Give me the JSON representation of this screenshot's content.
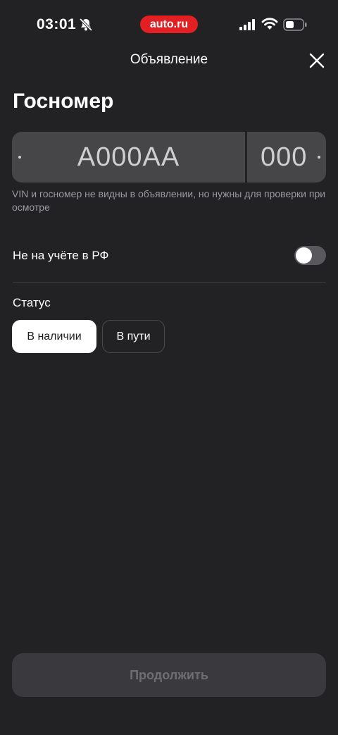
{
  "status_bar": {
    "time": "03:01",
    "app_badge": "auto.ru",
    "icons": [
      "bell-off-icon",
      "signal-icon",
      "wifi-icon",
      "battery-icon"
    ]
  },
  "header": {
    "title": "Объявление",
    "close_icon": "close-icon"
  },
  "page_title": "Госномер",
  "plate": {
    "number_placeholder": "А000АА",
    "region_placeholder": "000"
  },
  "hint": "VIN и госномер не видны в объявлении, но нужны для проверки при осмотре",
  "not_registered": {
    "label": "Не на учёте в РФ",
    "enabled": false
  },
  "status": {
    "label": "Статус",
    "options": [
      "В наличии",
      "В пути"
    ],
    "selected": "В наличии"
  },
  "continue_label": "Продолжить",
  "colors": {
    "background": "#222124",
    "brand_red": "#e21f23",
    "field": "#464548",
    "button_disabled": "#3a393d"
  }
}
